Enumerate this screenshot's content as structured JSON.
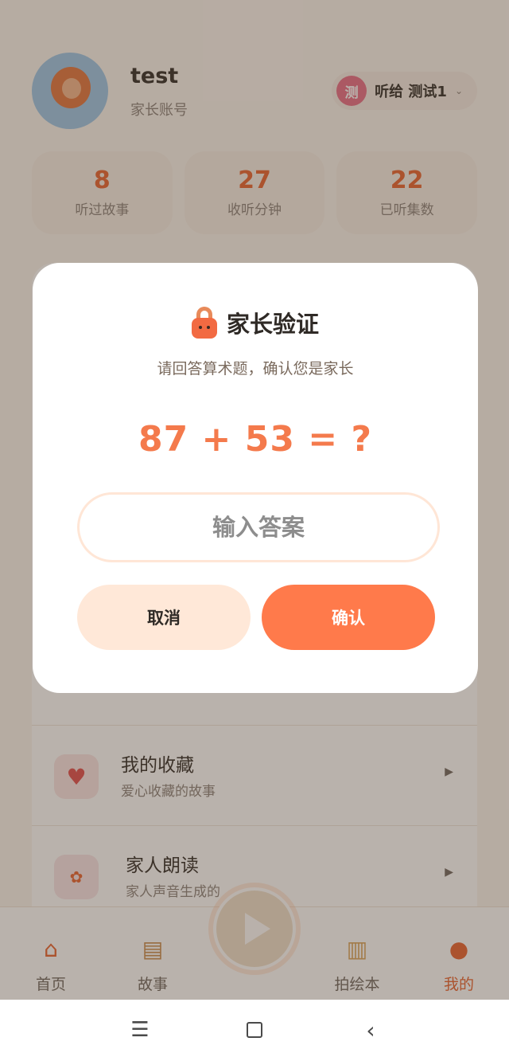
{
  "profile": {
    "name": "test",
    "role": "家长账号",
    "listen_avatar_text": "测",
    "listen_label": "听给 测试1",
    "listen_caret": "⌄"
  },
  "stats": [
    {
      "value": "8",
      "label": "听过故事"
    },
    {
      "value": "27",
      "label": "收听分钟"
    },
    {
      "value": "22",
      "label": "已听集数"
    }
  ],
  "menu": [
    {
      "title": "我的收藏",
      "subtitle": "爱心收藏的故事",
      "icon": "heart-icon"
    },
    {
      "title": "家人朗读",
      "subtitle": "家人声音生成的",
      "icon": "family-read-icon"
    }
  ],
  "tabs": [
    {
      "label": "首页",
      "icon": "home-icon"
    },
    {
      "label": "故事",
      "icon": "books-icon"
    },
    {
      "label": "拍绘本",
      "icon": "picture-book-icon"
    },
    {
      "label": "我的",
      "icon": "profile-icon"
    }
  ],
  "dialog": {
    "title": "家长验证",
    "subtitle": "请回答算术题，确认您是家长",
    "question": "87 + 53 = ?",
    "input_placeholder": "输入答案",
    "cancel_label": "取消",
    "confirm_label": "确认"
  },
  "system_nav": {
    "menu_glyph": "☰",
    "back_glyph": "‹"
  },
  "colors": {
    "accent": "#ff7a4b",
    "question": "#f47a4c",
    "cancel_bg": "#ffe8d8"
  }
}
